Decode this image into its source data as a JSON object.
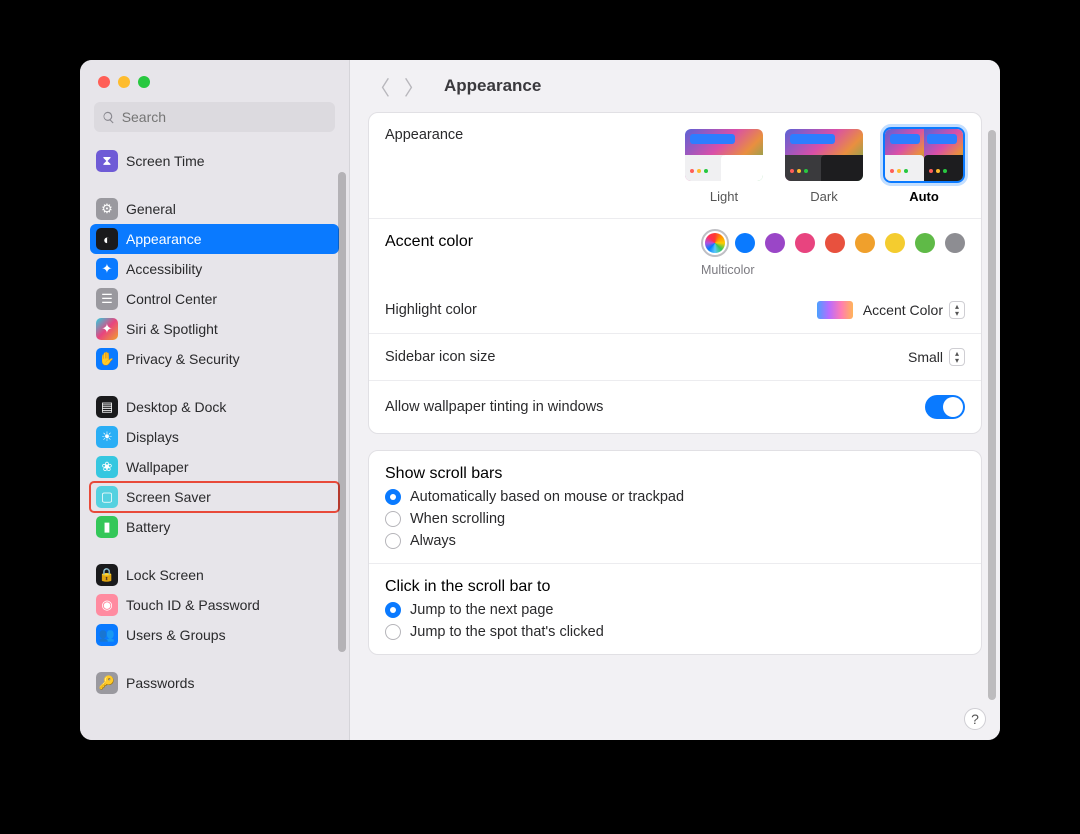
{
  "window_title": "Appearance",
  "search": {
    "placeholder": "Search"
  },
  "sidebar": {
    "items": [
      {
        "label": "Screen Time",
        "icon_bg": "#6f5bd6"
      },
      {
        "label": "General",
        "icon_bg": "#9a999f"
      },
      {
        "label": "Appearance",
        "icon_bg": "#1a1a1c"
      },
      {
        "label": "Accessibility",
        "icon_bg": "#0a7aff"
      },
      {
        "label": "Control Center",
        "icon_bg": "#9a999f"
      },
      {
        "label": "Siri & Spotlight",
        "icon_bg": "#1a1a1c"
      },
      {
        "label": "Privacy & Security",
        "icon_bg": "#0a7aff"
      },
      {
        "label": "Desktop & Dock",
        "icon_bg": "#1a1a1c"
      },
      {
        "label": "Displays",
        "icon_bg": "#2aaef5"
      },
      {
        "label": "Wallpaper",
        "icon_bg": "#36c7e0"
      },
      {
        "label": "Screen Saver",
        "icon_bg": "#55d1e0"
      },
      {
        "label": "Battery",
        "icon_bg": "#34c759"
      },
      {
        "label": "Lock Screen",
        "icon_bg": "#1a1a1c"
      },
      {
        "label": "Touch ID & Password",
        "icon_bg": "#ff8ba0"
      },
      {
        "label": "Users & Groups",
        "icon_bg": "#0a7aff"
      },
      {
        "label": "Passwords",
        "icon_bg": "#9a999f"
      }
    ]
  },
  "appearance": {
    "section_label": "Appearance",
    "options": {
      "light": "Light",
      "dark": "Dark",
      "auto": "Auto"
    },
    "selected": "Auto"
  },
  "accent": {
    "label": "Accent color",
    "selected_label": "Multicolor",
    "colors": [
      "multi",
      "#0a7aff",
      "#9a46c7",
      "#e8447f",
      "#e8513e",
      "#f0a02c",
      "#f4cc2f",
      "#5fba47",
      "#8d8d92"
    ]
  },
  "highlight": {
    "label": "Highlight color",
    "value": "Accent Color"
  },
  "sidebar_icon": {
    "label": "Sidebar icon size",
    "value": "Small"
  },
  "tinting": {
    "label": "Allow wallpaper tinting in windows",
    "on": true
  },
  "scrollbars": {
    "label": "Show scroll bars",
    "options": [
      "Automatically based on mouse or trackpad",
      "When scrolling",
      "Always"
    ],
    "selected_index": 0
  },
  "scrollclick": {
    "label": "Click in the scroll bar to",
    "options": [
      "Jump to the next page",
      "Jump to the spot that's clicked"
    ],
    "selected_index": 0
  }
}
